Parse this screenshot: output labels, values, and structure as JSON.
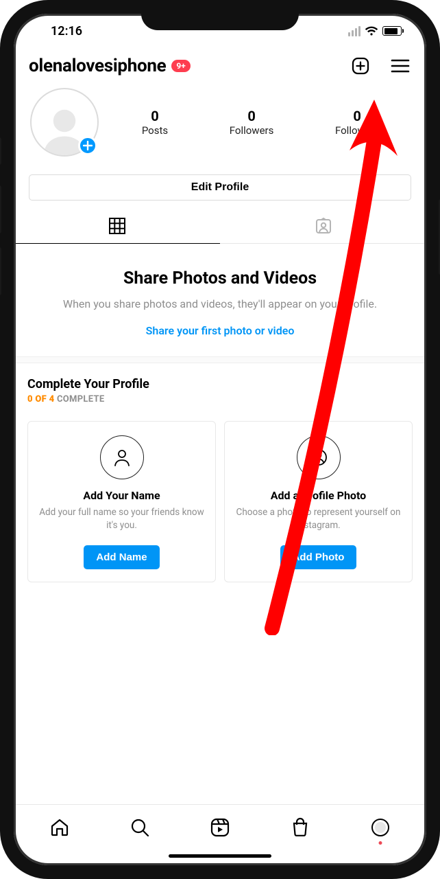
{
  "status": {
    "time": "12:16"
  },
  "header": {
    "username": "olenalovesiphone",
    "badge": "9+"
  },
  "profile": {
    "stats": {
      "posts": {
        "count": "0",
        "label": "Posts"
      },
      "followers": {
        "count": "0",
        "label": "Followers"
      },
      "following": {
        "count": "0",
        "label": "Following"
      }
    },
    "edit_label": "Edit Profile"
  },
  "empty": {
    "title": "Share Photos and Videos",
    "subtitle": "When you share photos and videos, they'll appear on your profile.",
    "cta": "Share your first photo or video"
  },
  "complete": {
    "title": "Complete Your Profile",
    "progress_done": "0 OF 4",
    "progress_rest": " COMPLETE",
    "cards": [
      {
        "title": "Add Your Name",
        "desc": "Add your full name so your friends know it's you.",
        "button": "Add Name"
      },
      {
        "title": "Add a Profile Photo",
        "desc": "Choose a photo to represent yourself on Instagram.",
        "button": "Add Photo"
      }
    ]
  }
}
